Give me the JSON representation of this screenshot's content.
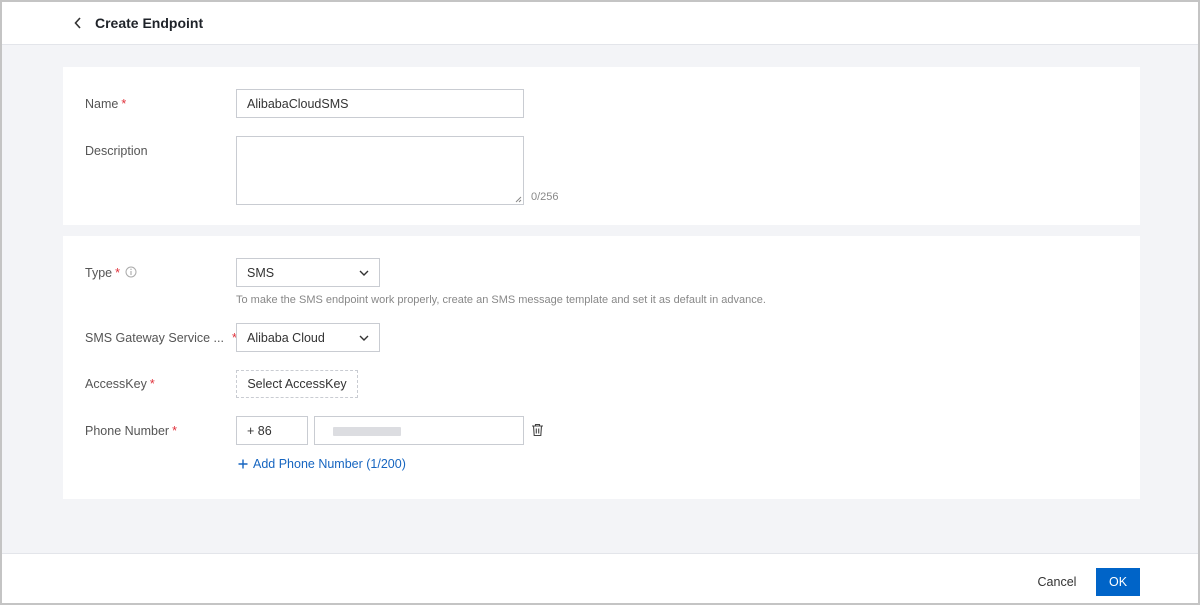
{
  "header": {
    "title": "Create Endpoint",
    "back_icon": "chevron-left-icon"
  },
  "basic": {
    "name_label": "Name",
    "name_value": "AlibabaCloudSMS",
    "description_label": "Description",
    "description_value": "",
    "description_counter": "0/256"
  },
  "config": {
    "type_label": "Type",
    "type_value": "SMS",
    "type_hint": "To make the SMS endpoint work properly, create an SMS message template and set it as default in advance.",
    "gateway_label": "SMS Gateway Service ...",
    "gateway_value": "Alibaba Cloud",
    "accesskey_label": "AccessKey",
    "accesskey_button": "Select AccessKey",
    "phone_label": "Phone Number",
    "country_code": "+ 86",
    "add_phone_label": "Add Phone Number (1/200)"
  },
  "required_mark": "*",
  "footer": {
    "cancel_label": "Cancel",
    "ok_label": "OK"
  },
  "colors": {
    "primary": "#0064c8",
    "link": "#1665c0",
    "required": "#e0303a"
  }
}
